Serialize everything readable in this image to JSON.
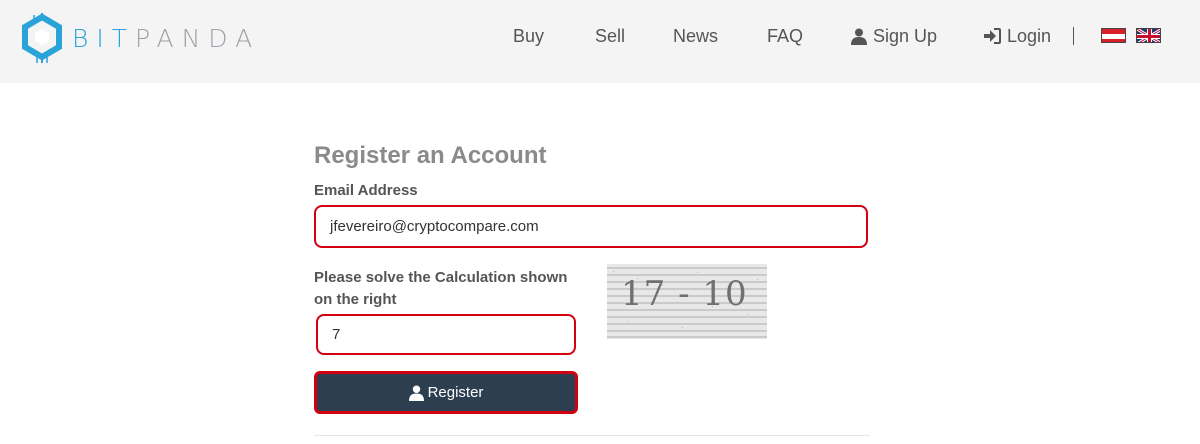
{
  "brand": {
    "bit": "BIT",
    "panda": "PANDA",
    "color_primary": "#2aa3d8",
    "color_secondary": "#9aa2a8"
  },
  "nav": {
    "items": [
      {
        "label": "Buy"
      },
      {
        "label": "Sell"
      },
      {
        "label": "News"
      },
      {
        "label": "FAQ"
      },
      {
        "label": "Sign Up",
        "icon": "user-icon"
      },
      {
        "label": "Login",
        "icon": "login-icon"
      }
    ],
    "languages": [
      {
        "name": "austria-flag-icon"
      },
      {
        "name": "uk-flag-icon"
      }
    ]
  },
  "form": {
    "title": "Register an Account",
    "email_label": "Email Address",
    "email_value": "jfevereiro@cryptocompare.com",
    "captcha_label_line1": "Please solve the Calculation shown",
    "captcha_label_line2": "on the right",
    "captcha_text": "17 - 10",
    "captcha_answer": "7",
    "register_label": "Register",
    "highlight_color": "#d4000f",
    "button_color": "#2d3e50"
  }
}
